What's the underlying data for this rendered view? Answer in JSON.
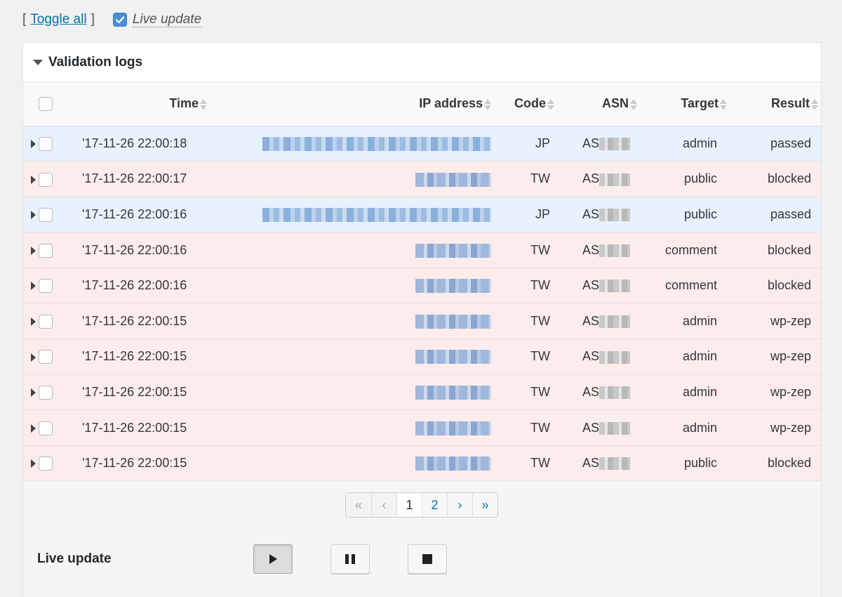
{
  "topbar": {
    "bracket_open": "[",
    "toggle_all": "Toggle all",
    "bracket_close": "]",
    "live_update_label": "Live update",
    "live_update_checked": true
  },
  "panel": {
    "title": "Validation logs",
    "columns": [
      "Time",
      "IP address",
      "Code",
      "ASN",
      "Target",
      "Result"
    ],
    "rows": [
      {
        "time": "'17-11-26 22:00:18",
        "ip": "",
        "code": "JP",
        "asn": "AS",
        "target": "admin",
        "result": "passed"
      },
      {
        "time": "'17-11-26 22:00:17",
        "ip": "",
        "code": "TW",
        "asn": "AS",
        "target": "public",
        "result": "blocked"
      },
      {
        "time": "'17-11-26 22:00:16",
        "ip": "",
        "code": "JP",
        "asn": "AS",
        "target": "public",
        "result": "passed"
      },
      {
        "time": "'17-11-26 22:00:16",
        "ip": "",
        "code": "TW",
        "asn": "AS",
        "target": "comment",
        "result": "blocked"
      },
      {
        "time": "'17-11-26 22:00:16",
        "ip": "",
        "code": "TW",
        "asn": "AS",
        "target": "comment",
        "result": "blocked"
      },
      {
        "time": "'17-11-26 22:00:15",
        "ip": "",
        "code": "TW",
        "asn": "AS",
        "target": "admin",
        "result": "wp-zep"
      },
      {
        "time": "'17-11-26 22:00:15",
        "ip": "",
        "code": "TW",
        "asn": "AS",
        "target": "admin",
        "result": "wp-zep"
      },
      {
        "time": "'17-11-26 22:00:15",
        "ip": "",
        "code": "TW",
        "asn": "AS",
        "target": "admin",
        "result": "wp-zep"
      },
      {
        "time": "'17-11-26 22:00:15",
        "ip": "",
        "code": "TW",
        "asn": "AS",
        "target": "admin",
        "result": "wp-zep"
      },
      {
        "time": "'17-11-26 22:00:15",
        "ip": "",
        "code": "TW",
        "asn": "AS",
        "target": "public",
        "result": "blocked"
      }
    ]
  },
  "pagination": {
    "first": "«",
    "prev": "‹",
    "pages": [
      "1",
      "2"
    ],
    "current": "1",
    "next": "›",
    "last": "»"
  },
  "live_controls": {
    "title": "Live update",
    "buttons": [
      "play-icon",
      "pause-icon",
      "stop-icon"
    ],
    "active": "play-icon"
  },
  "colors": {
    "passed_row": "#e8f2fc",
    "blocked_row": "#fdecec",
    "link": "#0073aa",
    "checkbox_checked": "#4a90d9"
  }
}
